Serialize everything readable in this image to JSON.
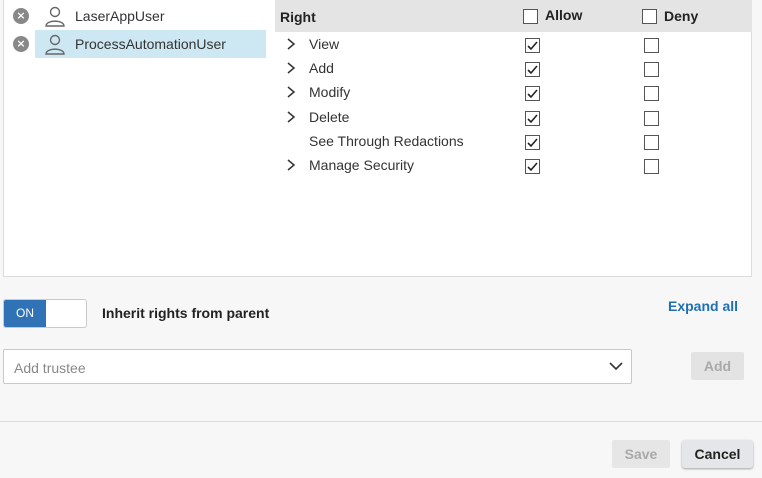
{
  "trustees": [
    {
      "name": "LaserAppUser",
      "selected": false
    },
    {
      "name": "ProcessAutomationUser",
      "selected": true
    }
  ],
  "rights_table": {
    "header_right": "Right",
    "header_allow": "Allow",
    "header_deny": "Deny",
    "rows": [
      {
        "label": "View",
        "expandable": true,
        "allow": true,
        "deny": false
      },
      {
        "label": "Add",
        "expandable": true,
        "allow": true,
        "deny": false
      },
      {
        "label": "Modify",
        "expandable": true,
        "allow": true,
        "deny": false
      },
      {
        "label": "Delete",
        "expandable": true,
        "allow": true,
        "deny": false
      },
      {
        "label": "See Through Redactions",
        "expandable": false,
        "allow": true,
        "deny": false
      },
      {
        "label": "Manage Security",
        "expandable": true,
        "allow": true,
        "deny": false
      }
    ]
  },
  "inherit": {
    "toggle_label": "ON",
    "label": "Inherit rights from parent",
    "on": true
  },
  "expand_all_label": "Expand all",
  "add_trustee": {
    "placeholder": "Add trustee",
    "value": ""
  },
  "buttons": {
    "add": "Add",
    "save": "Save",
    "cancel": "Cancel"
  },
  "colors": {
    "accent": "#2f72b5",
    "selected_row": "#cde8f2",
    "link": "#1f6fb5"
  },
  "icons": {
    "remove": "close-circle-icon",
    "user": "user-icon",
    "expand": "chevron-right-icon",
    "dropdown": "chevron-down-icon",
    "check": "checkmark-icon"
  }
}
